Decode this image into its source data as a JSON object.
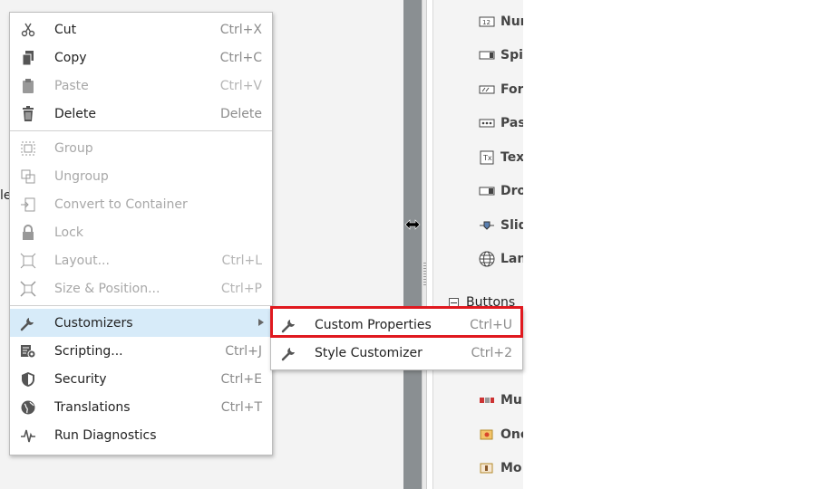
{
  "background": {
    "edge_text": "le"
  },
  "component_panel": {
    "items": [
      {
        "label": "Nur",
        "icon": "numeric-field-icon"
      },
      {
        "label": "Spir",
        "icon": "spinner-icon"
      },
      {
        "label": "For",
        "icon": "formatted-field-icon"
      },
      {
        "label": "Pas",
        "icon": "password-field-icon"
      },
      {
        "label": "Tex",
        "icon": "text-area-icon"
      },
      {
        "label": "Dro",
        "icon": "dropdown-icon"
      },
      {
        "label": "Slid",
        "icon": "slider-icon"
      },
      {
        "label": "Lan",
        "icon": "globe-icon"
      }
    ],
    "section": "Buttons",
    "section_items": [
      {
        "label": "Mu",
        "icon": "multistate-button-icon"
      },
      {
        "label": "One",
        "icon": "one-shot-button-icon"
      },
      {
        "label": "Mo",
        "icon": "momentary-button-icon"
      }
    ]
  },
  "context_menu": {
    "items": [
      {
        "label": "Cut",
        "shortcut": "Ctrl+X",
        "icon": "scissors-icon"
      },
      {
        "label": "Copy",
        "shortcut": "Ctrl+C",
        "icon": "copy-icon"
      },
      {
        "label": "Paste",
        "shortcut": "Ctrl+V",
        "icon": "clipboard-icon"
      },
      {
        "label": "Delete",
        "shortcut": "Delete",
        "icon": "trash-icon"
      },
      {
        "label": "Group",
        "shortcut": "",
        "icon": "group-icon"
      },
      {
        "label": "Ungroup",
        "shortcut": "",
        "icon": "ungroup-icon"
      },
      {
        "label": "Convert to Container",
        "shortcut": "",
        "icon": "convert-container-icon"
      },
      {
        "label": "Lock",
        "shortcut": "",
        "icon": "lock-icon"
      },
      {
        "label": "Layout...",
        "shortcut": "Ctrl+L",
        "icon": "layout-icon"
      },
      {
        "label": "Size & Position...",
        "shortcut": "Ctrl+P",
        "icon": "size-position-icon"
      },
      {
        "label": "Customizers",
        "shortcut": "",
        "icon": "wrench-icon"
      },
      {
        "label": "Scripting...",
        "shortcut": "Ctrl+J",
        "icon": "script-gear-icon"
      },
      {
        "label": "Security",
        "shortcut": "Ctrl+E",
        "icon": "shield-icon"
      },
      {
        "label": "Translations",
        "shortcut": "Ctrl+T",
        "icon": "globe-icon"
      },
      {
        "label": "Run Diagnostics",
        "shortcut": "",
        "icon": "pulse-icon"
      }
    ]
  },
  "submenu": {
    "items": [
      {
        "label": "Custom Properties",
        "shortcut": "Ctrl+U",
        "icon": "wrench-icon"
      },
      {
        "label": "Style Customizer",
        "shortcut": "Ctrl+2",
        "icon": "wrench-icon"
      }
    ]
  }
}
